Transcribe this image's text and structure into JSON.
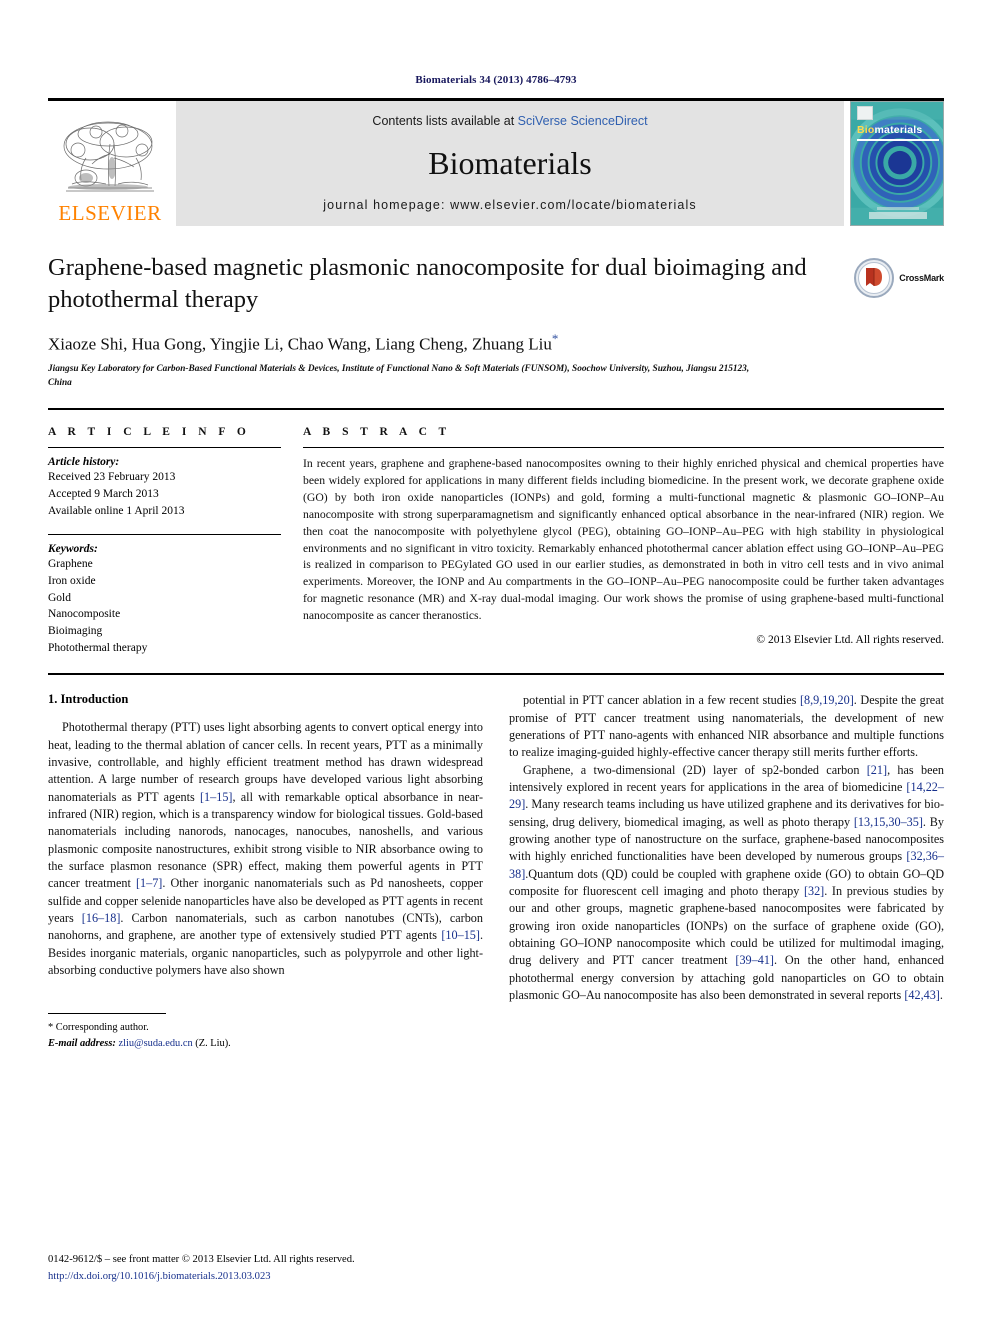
{
  "running_head": "Biomaterials 34 (2013) 4786–4793",
  "masthead": {
    "publisher_name": "ELSEVIER",
    "contents_prefix": "Contents lists available at ",
    "contents_link": "SciVerse ScienceDirect",
    "journal_title": "Biomaterials",
    "homepage": "journal homepage: www.elsevier.com/locate/biomaterials",
    "cover_label_bio": "Bio",
    "cover_label_materials": "materials"
  },
  "title_block": {
    "title": "Graphene-based magnetic plasmonic nanocomposite for dual bioimaging and photothermal therapy",
    "authors": "Xiaoze Shi, Hua Gong, Yingjie Li, Chao Wang, Liang Cheng, Zhuang Liu",
    "corresponding_marker": "*",
    "affiliation": "Jiangsu Key Laboratory for Carbon-Based Functional Materials & Devices, Institute of Functional Nano & Soft Materials (FUNSOM), Soochow University, Suzhou, Jiangsu 215123, China",
    "crossmark_label": "CrossMark"
  },
  "article_info": {
    "heading": "A R T I C L E  I N F O",
    "history_label": "Article history:",
    "history": [
      "Received 23 February 2013",
      "Accepted 9 March 2013",
      "Available online 1 April 2013"
    ],
    "keywords_label": "Keywords:",
    "keywords": [
      "Graphene",
      "Iron oxide",
      "Gold",
      "Nanocomposite",
      "Bioimaging",
      "Photothermal therapy"
    ]
  },
  "abstract": {
    "heading": "A B S T R A C T",
    "text": "In recent years, graphene and graphene-based nanocomposites owning to their highly enriched physical and chemical properties have been widely explored for applications in many different fields including biomedicine. In the present work, we decorate graphene oxide (GO) by both iron oxide nanoparticles (IONPs) and gold, forming a multi-functional magnetic & plasmonic GO–IONP–Au nanocomposite with strong superparamagnetism and significantly enhanced optical absorbance in the near-infrared (NIR) region. We then coat the nanocomposite with polyethylene glycol (PEG), obtaining GO–IONP–Au–PEG with high stability in physiological environments and no significant in vitro toxicity. Remarkably enhanced photothermal cancer ablation effect using GO–IONP–Au–PEG is realized in comparison to PEGylated GO used in our earlier studies, as demonstrated in both in vitro cell tests and in vivo animal experiments. Moreover, the IONP and Au compartments in the GO–IONP–Au–PEG nanocomposite could be further taken advantages for magnetic resonance (MR) and X-ray dual-modal imaging. Our work shows the promise of using graphene-based multi-functional nanocomposite as cancer theranostics.",
    "copyright": "© 2013 Elsevier Ltd. All rights reserved."
  },
  "body": {
    "section_heading": "1. Introduction",
    "left_paragraphs": [
      "Photothermal therapy (PTT) uses light absorbing agents to convert optical energy into heat, leading to the thermal ablation of cancer cells. In recent years, PTT as a minimally invasive, controllable, and highly efficient treatment method has drawn widespread attention. A large number of research groups have developed various light absorbing nanomaterials as PTT agents [1–15], all with remarkable optical absorbance in near-infrared (NIR) region, which is a transparency window for biological tissues. Gold-based nanomaterials including nanorods, nanocages, nanocubes, nanoshells, and various plasmonic composite nanostructures, exhibit strong visible to NIR absorbance owing to the surface plasmon resonance (SPR) effect, making them powerful agents in PTT cancer treatment [1–7]. Other inorganic nanomaterials such as Pd nanosheets, copper sulfide and copper selenide nanoparticles have also be developed as PTT agents in recent years [16–18]. Carbon nanomaterials, such as carbon nanotubes (CNTs), carbon nanohorns, and graphene, are another type of extensively studied PTT agents [10–15]. Besides inorganic materials, organic nanoparticles, such as polypyrrole and other light-absorbing conductive polymers have also shown"
    ],
    "right_paragraphs": [
      "potential in PTT cancer ablation in a few recent studies [8,9,19,20]. Despite the great promise of PTT cancer treatment using nanomaterials, the development of new generations of PTT nano-agents with enhanced NIR absorbance and multiple functions to realize imaging-guided highly-effective cancer therapy still merits further efforts.",
      "Graphene, a two-dimensional (2D) layer of sp2-bonded carbon [21], has been intensively explored in recent years for applications in the area of biomedicine [14,22–29]. Many research teams including us have utilized graphene and its derivatives for bio-sensing, drug delivery, biomedical imaging, as well as photo therapy [13,15,30–35]. By growing another type of nanostructure on the surface, graphene-based nanocomposites with highly enriched functionalities have been developed by numerous groups [32,36–38].Quantum dots (QD) could be coupled with graphene oxide (GO) to obtain GO–QD composite for fluorescent cell imaging and photo therapy [32]. In previous studies by our and other groups, magnetic graphene-based nanocomposites were fabricated by growing iron oxide nanoparticles (IONPs) on the surface of graphene oxide (GO), obtaining GO–IONP nanocomposite which could be utilized for multimodal imaging, drug delivery and PTT cancer treatment [39–41]. On the other hand, enhanced photothermal energy conversion by attaching gold nanoparticles on GO to obtain plasmonic GO–Au nanocomposite has also been demonstrated in several reports [42,43]."
    ]
  },
  "footnote": {
    "corresponding": "* Corresponding author.",
    "email_label": "E-mail address:",
    "email": "zliu@suda.edu.cn",
    "email_suffix": "(Z. Liu)."
  },
  "footer": {
    "front_matter": "0142-9612/$ – see front matter © 2013 Elsevier Ltd. All rights reserved.",
    "doi": "http://dx.doi.org/10.1016/j.biomaterials.2013.03.023"
  },
  "colors": {
    "elsevier_orange": "#ff8200",
    "link_blue": "#17308c",
    "sciencedirect_blue": "#3060b0",
    "masthead_gray": "#e3e3e3",
    "cover_teal": "#2fa8a8",
    "crossmark_red": "#b8321f"
  }
}
